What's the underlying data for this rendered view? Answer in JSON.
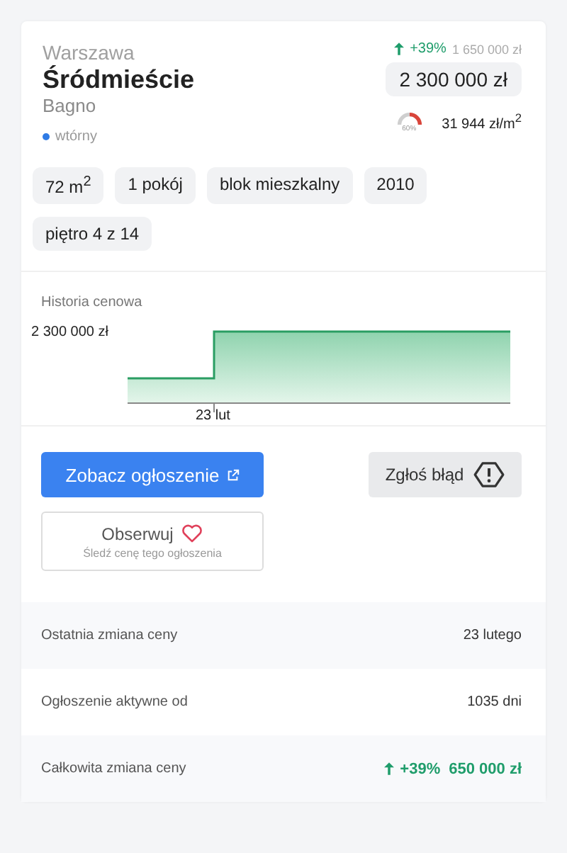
{
  "location": {
    "city": "Warszawa",
    "district": "Śródmieście",
    "subdistrict": "Bagno",
    "market": "wtórny"
  },
  "price": {
    "change": "+39%",
    "old_price": "1 650 000 zł",
    "current": "2 300 000 zł",
    "gauge_label": "60%",
    "per_m2": "31 944 zł/m$^{2}$"
  },
  "tags": [
    "72 m$^{2}$",
    "1 pokój",
    "blok mieszkalny",
    "2010",
    "piętro 4 z 14"
  ],
  "history": {
    "title": "Historia cenowa",
    "y_label": "2 300 000 zł",
    "x_label": "23 lut"
  },
  "actions": {
    "view": "Zobacz ogłoszenie",
    "report": "Zgłoś błąd",
    "watch": "Obserwuj",
    "watch_hint": "Śledź cenę tego ogłoszenia"
  },
  "details": [
    {
      "label": "Ostatnia zmiana ceny",
      "value": "23 lutego",
      "kind": "plain"
    },
    {
      "label": "Ogłoszenie aktywne od",
      "value": "1035 dni",
      "kind": "plain"
    },
    {
      "label": "Całkowita zmiana ceny",
      "value": "+39%",
      "amount": "650 000 zł",
      "kind": "change"
    }
  ]
}
